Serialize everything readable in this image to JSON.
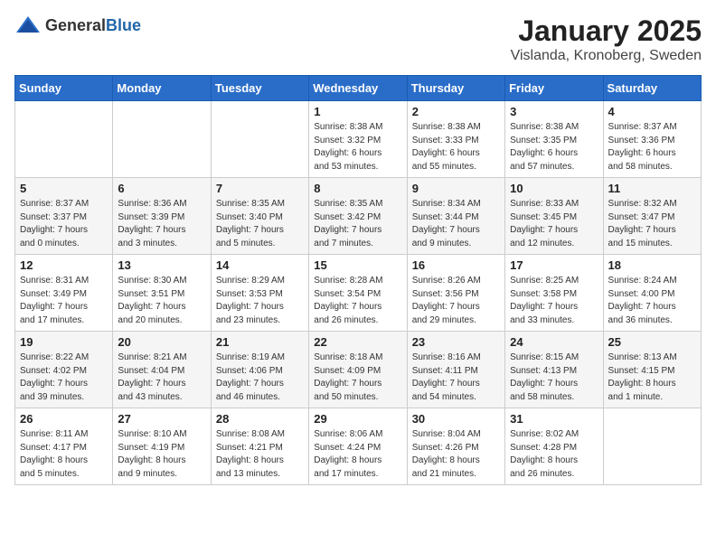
{
  "header": {
    "logo_general": "General",
    "logo_blue": "Blue",
    "month": "January 2025",
    "location": "Vislanda, Kronoberg, Sweden"
  },
  "days_of_week": [
    "Sunday",
    "Monday",
    "Tuesday",
    "Wednesday",
    "Thursday",
    "Friday",
    "Saturday"
  ],
  "weeks": [
    [
      {
        "day": "",
        "info": ""
      },
      {
        "day": "",
        "info": ""
      },
      {
        "day": "",
        "info": ""
      },
      {
        "day": "1",
        "info": "Sunrise: 8:38 AM\nSunset: 3:32 PM\nDaylight: 6 hours\nand 53 minutes."
      },
      {
        "day": "2",
        "info": "Sunrise: 8:38 AM\nSunset: 3:33 PM\nDaylight: 6 hours\nand 55 minutes."
      },
      {
        "day": "3",
        "info": "Sunrise: 8:38 AM\nSunset: 3:35 PM\nDaylight: 6 hours\nand 57 minutes."
      },
      {
        "day": "4",
        "info": "Sunrise: 8:37 AM\nSunset: 3:36 PM\nDaylight: 6 hours\nand 58 minutes."
      }
    ],
    [
      {
        "day": "5",
        "info": "Sunrise: 8:37 AM\nSunset: 3:37 PM\nDaylight: 7 hours\nand 0 minutes."
      },
      {
        "day": "6",
        "info": "Sunrise: 8:36 AM\nSunset: 3:39 PM\nDaylight: 7 hours\nand 3 minutes."
      },
      {
        "day": "7",
        "info": "Sunrise: 8:35 AM\nSunset: 3:40 PM\nDaylight: 7 hours\nand 5 minutes."
      },
      {
        "day": "8",
        "info": "Sunrise: 8:35 AM\nSunset: 3:42 PM\nDaylight: 7 hours\nand 7 minutes."
      },
      {
        "day": "9",
        "info": "Sunrise: 8:34 AM\nSunset: 3:44 PM\nDaylight: 7 hours\nand 9 minutes."
      },
      {
        "day": "10",
        "info": "Sunrise: 8:33 AM\nSunset: 3:45 PM\nDaylight: 7 hours\nand 12 minutes."
      },
      {
        "day": "11",
        "info": "Sunrise: 8:32 AM\nSunset: 3:47 PM\nDaylight: 7 hours\nand 15 minutes."
      }
    ],
    [
      {
        "day": "12",
        "info": "Sunrise: 8:31 AM\nSunset: 3:49 PM\nDaylight: 7 hours\nand 17 minutes."
      },
      {
        "day": "13",
        "info": "Sunrise: 8:30 AM\nSunset: 3:51 PM\nDaylight: 7 hours\nand 20 minutes."
      },
      {
        "day": "14",
        "info": "Sunrise: 8:29 AM\nSunset: 3:53 PM\nDaylight: 7 hours\nand 23 minutes."
      },
      {
        "day": "15",
        "info": "Sunrise: 8:28 AM\nSunset: 3:54 PM\nDaylight: 7 hours\nand 26 minutes."
      },
      {
        "day": "16",
        "info": "Sunrise: 8:26 AM\nSunset: 3:56 PM\nDaylight: 7 hours\nand 29 minutes."
      },
      {
        "day": "17",
        "info": "Sunrise: 8:25 AM\nSunset: 3:58 PM\nDaylight: 7 hours\nand 33 minutes."
      },
      {
        "day": "18",
        "info": "Sunrise: 8:24 AM\nSunset: 4:00 PM\nDaylight: 7 hours\nand 36 minutes."
      }
    ],
    [
      {
        "day": "19",
        "info": "Sunrise: 8:22 AM\nSunset: 4:02 PM\nDaylight: 7 hours\nand 39 minutes."
      },
      {
        "day": "20",
        "info": "Sunrise: 8:21 AM\nSunset: 4:04 PM\nDaylight: 7 hours\nand 43 minutes."
      },
      {
        "day": "21",
        "info": "Sunrise: 8:19 AM\nSunset: 4:06 PM\nDaylight: 7 hours\nand 46 minutes."
      },
      {
        "day": "22",
        "info": "Sunrise: 8:18 AM\nSunset: 4:09 PM\nDaylight: 7 hours\nand 50 minutes."
      },
      {
        "day": "23",
        "info": "Sunrise: 8:16 AM\nSunset: 4:11 PM\nDaylight: 7 hours\nand 54 minutes."
      },
      {
        "day": "24",
        "info": "Sunrise: 8:15 AM\nSunset: 4:13 PM\nDaylight: 7 hours\nand 58 minutes."
      },
      {
        "day": "25",
        "info": "Sunrise: 8:13 AM\nSunset: 4:15 PM\nDaylight: 8 hours\nand 1 minute."
      }
    ],
    [
      {
        "day": "26",
        "info": "Sunrise: 8:11 AM\nSunset: 4:17 PM\nDaylight: 8 hours\nand 5 minutes."
      },
      {
        "day": "27",
        "info": "Sunrise: 8:10 AM\nSunset: 4:19 PM\nDaylight: 8 hours\nand 9 minutes."
      },
      {
        "day": "28",
        "info": "Sunrise: 8:08 AM\nSunset: 4:21 PM\nDaylight: 8 hours\nand 13 minutes."
      },
      {
        "day": "29",
        "info": "Sunrise: 8:06 AM\nSunset: 4:24 PM\nDaylight: 8 hours\nand 17 minutes."
      },
      {
        "day": "30",
        "info": "Sunrise: 8:04 AM\nSunset: 4:26 PM\nDaylight: 8 hours\nand 21 minutes."
      },
      {
        "day": "31",
        "info": "Sunrise: 8:02 AM\nSunset: 4:28 PM\nDaylight: 8 hours\nand 26 minutes."
      },
      {
        "day": "",
        "info": ""
      }
    ]
  ]
}
